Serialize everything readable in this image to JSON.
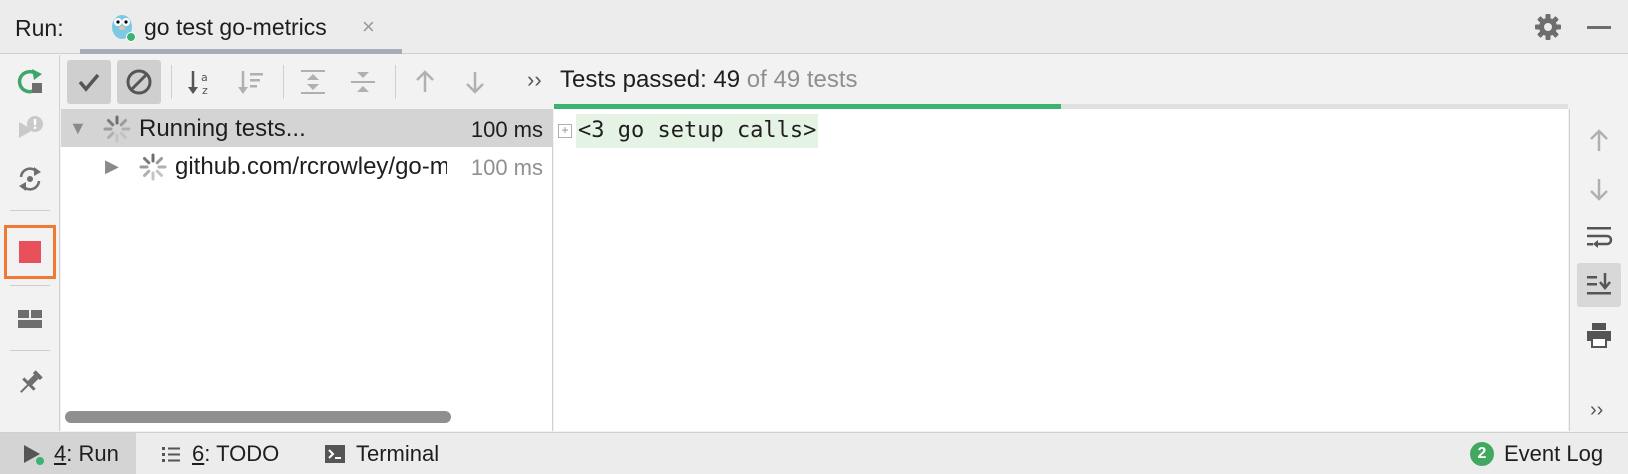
{
  "header": {
    "run_label": "Run:",
    "tab_title": "go test go-metrics",
    "tab_close": "×"
  },
  "left_toolbar": {
    "icons": [
      "rerun-icon",
      "rerun-failed-icon",
      "toggle-auto-test-icon",
      "stop-icon",
      "layout-icon",
      "pin-icon"
    ]
  },
  "tree_toolbar": {
    "icons": [
      "show-passed-icon",
      "show-ignored-icon",
      "sort-alphabetically-icon",
      "sort-by-duration-icon",
      "expand-all-icon",
      "collapse-all-icon",
      "previous-test-icon",
      "next-test-icon"
    ],
    "more": "››"
  },
  "status": {
    "passed": "Tests passed: 49",
    "total": "of 49 tests",
    "progress_fraction": 0.5
  },
  "tree": {
    "rows": [
      {
        "label": "Running tests...",
        "time": "100 ms"
      },
      {
        "label": "github.com/rcrowley/go-metrics",
        "time": "100 ms"
      }
    ]
  },
  "console": {
    "fold_marker": "+",
    "folded_text": "<3 go setup calls>"
  },
  "right_toolbar": {
    "icons": [
      "up-stack-icon",
      "down-stack-icon",
      "soft-wrap-icon",
      "scroll-to-end-icon",
      "print-icon"
    ],
    "more": "››"
  },
  "bottom_bar": {
    "run": {
      "number": "4",
      "label": ": Run"
    },
    "todo": {
      "number": "6",
      "label": ": TODO"
    },
    "terminal": "Terminal",
    "event_log": {
      "count": "2",
      "label": "Event Log"
    }
  },
  "colors": {
    "stop_red": "#e8505b",
    "highlight_orange": "#f07a33",
    "progress_green": "#3cb371",
    "rerun_green": "#3fa66a",
    "badge_green": "#41a85f"
  }
}
